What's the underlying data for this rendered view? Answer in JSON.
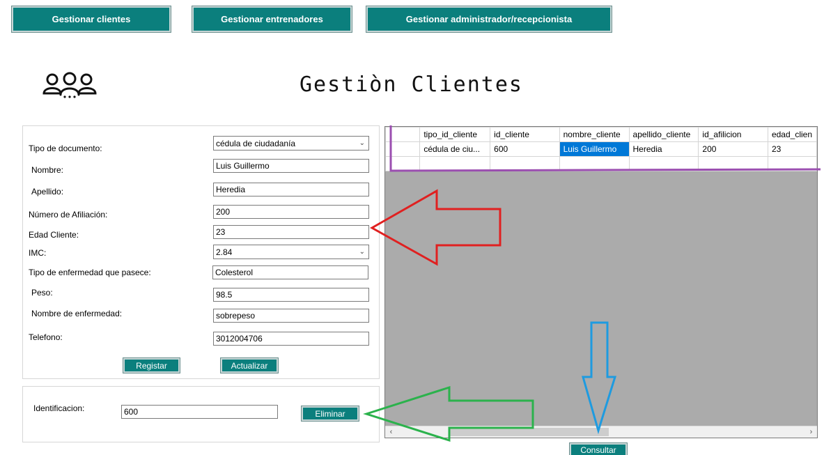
{
  "nav": {
    "clientes": "Gestionar clientes",
    "entrenadores": "Gestionar entrenadores",
    "administrador": "Gestionar administrador/recepcionista"
  },
  "page_title": "Gestiòn Clientes",
  "form": {
    "tipo_documento_label": "Tipo de documento:",
    "tipo_documento_value": "cédula de ciudadanía",
    "nombre_label": "Nombre:",
    "nombre_value": "Luis Guillermo",
    "apellido_label": "Apellido:",
    "apellido_value": "Heredia",
    "afiliacion_label": "Número de Afiliación:",
    "afiliacion_value": "200",
    "edad_label": "Edad Cliente:",
    "edad_value": "23",
    "imc_label": "IMC:",
    "imc_value": "2.84",
    "tipo_enfermedad_label": "Tipo de enfermedad que pasece:",
    "tipo_enfermedad_value": "Colesterol",
    "peso_label": "Peso:",
    "peso_value": "98.5",
    "nombre_enfermedad_label": "Nombre de enfermedad:",
    "nombre_enfermedad_value": "sobrepeso",
    "telefono_label": "Telefono:",
    "telefono_value": "3012004706",
    "registrar": "Registar",
    "actualizar": "Actualizar"
  },
  "delete_panel": {
    "label": "Identificacion:",
    "value": "600",
    "button": "Eliminar"
  },
  "grid": {
    "columns": [
      "tipo_id_cliente",
      "id_cliente",
      "nombre_cliente",
      "apellido_cliente",
      "id_afilicion",
      "edad_clien"
    ],
    "rows": [
      [
        "cédula de ciu...",
        "600",
        "Luis Guillermo",
        "Heredia",
        "200",
        "23"
      ]
    ]
  },
  "consultar": "Consultar",
  "colors": {
    "button_teal": "#0b7f7d",
    "grid_background": "#ababab",
    "selection_blue": "#0078d7",
    "annotation_red": "#e02020",
    "annotation_green": "#2bb24c",
    "annotation_blue": "#1e9be0",
    "annotation_purple": "#9b4fb0"
  },
  "icons": [
    "users-icon",
    "chevron-down-icon",
    "scroll-left-icon",
    "scroll-right-icon"
  ]
}
